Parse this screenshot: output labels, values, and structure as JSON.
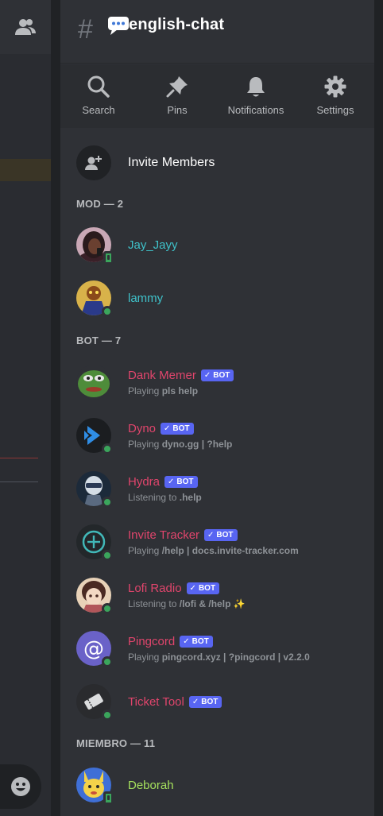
{
  "channel": {
    "name": "english-chat"
  },
  "toolbar": [
    {
      "label": "Search",
      "icon": "search-icon"
    },
    {
      "label": "Pins",
      "icon": "pin-icon"
    },
    {
      "label": "Notifications",
      "icon": "bell-icon"
    },
    {
      "label": "Settings",
      "icon": "gear-icon"
    }
  ],
  "invite": {
    "label": "Invite Members"
  },
  "sections": {
    "mod": "MOD — 2",
    "bot": "BOT — 7",
    "miembro": "MIEMBRO — 11"
  },
  "bot_tag": "BOT",
  "members": {
    "mod": [
      {
        "name": "Jay_Jayy",
        "color": "#3fc1c9",
        "status": "mobile"
      },
      {
        "name": "lammy",
        "color": "#3fc1c9",
        "status": "online"
      }
    ],
    "bot": [
      {
        "name": "Dank Memer",
        "verb": "Playing",
        "detail": "pls help"
      },
      {
        "name": "Dyno",
        "verb": "Playing",
        "detail": "dyno.gg | ?help"
      },
      {
        "name": "Hydra",
        "verb": "Listening to",
        "detail": ".help"
      },
      {
        "name": "Invite Tracker",
        "verb": "Playing",
        "detail": "/help | docs.invite-tracker.com"
      },
      {
        "name": "Lofi Radio",
        "verb": "Listening to",
        "detail": "/lofi & /help ✨"
      },
      {
        "name": "Pingcord",
        "verb": "Playing",
        "detail": "pingcord.xyz | ?pingcord | v2.2.0"
      },
      {
        "name": "Ticket Tool",
        "verb": "",
        "detail": ""
      }
    ],
    "miembro": [
      {
        "name": "Deborah",
        "color": "#a5e05d",
        "status": "mobile"
      }
    ]
  },
  "colors": {
    "bot_name": "#e0456c",
    "bot_tag_bg": "#5865f2",
    "online": "#3ba55c",
    "background": "#2f3136"
  }
}
